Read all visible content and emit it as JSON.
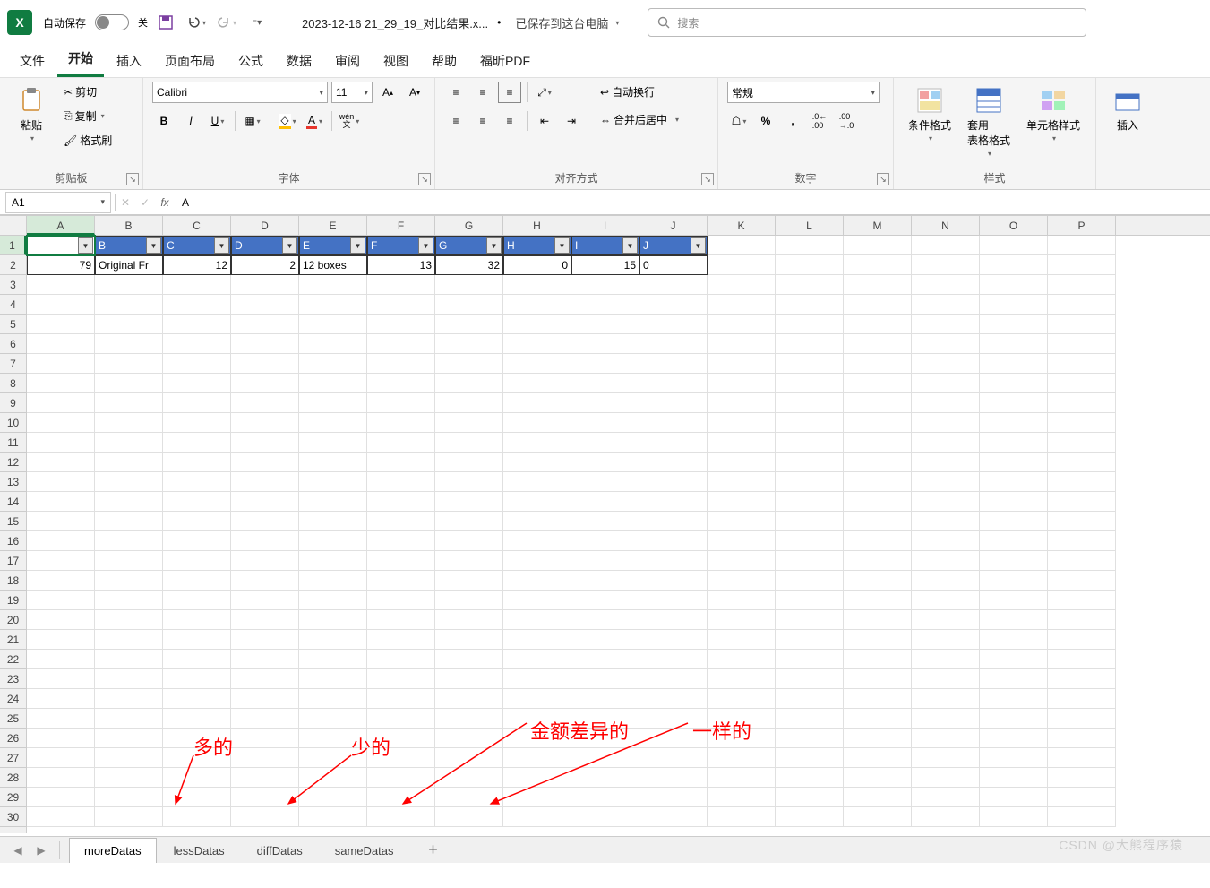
{
  "title": {
    "autosave": "自动保存",
    "autosave_state": "关",
    "filename": "2023-12-16 21_29_19_对比结果.x...",
    "saved": "已保存到这台电脑",
    "search_ph": "搜索"
  },
  "tabs": {
    "file": "文件",
    "home": "开始",
    "insert": "插入",
    "layout": "页面布局",
    "formulas": "公式",
    "data": "数据",
    "review": "审阅",
    "view": "视图",
    "help": "帮助",
    "foxit": "福昕PDF"
  },
  "ribbon": {
    "clipboard": {
      "paste": "粘贴",
      "cut": "剪切",
      "copy": "复制",
      "painter": "格式刷",
      "label": "剪贴板"
    },
    "font": {
      "name": "Calibri",
      "size": "11",
      "label": "字体"
    },
    "align": {
      "wrap": "自动换行",
      "merge": "合并后居中",
      "label": "对齐方式"
    },
    "number": {
      "format": "常规",
      "label": "数字"
    },
    "styles": {
      "cond": "条件格式",
      "table": "套用\n表格格式",
      "cell": "单元格样式",
      "label": "样式"
    },
    "cells": {
      "insert": "插入"
    }
  },
  "formula": {
    "ref": "A1",
    "value": "A"
  },
  "columns": [
    "A",
    "B",
    "C",
    "D",
    "E",
    "F",
    "G",
    "H",
    "I",
    "J",
    "K",
    "L",
    "M",
    "N",
    "O",
    "P"
  ],
  "row_count": 30,
  "header_row": [
    "A",
    "B",
    "C",
    "D",
    "E",
    "F",
    "G",
    "H",
    "I",
    "J"
  ],
  "data_row": [
    "79",
    "Original Fr",
    "12",
    "2",
    "12 boxes",
    "13",
    "32",
    "0",
    "15",
    "0"
  ],
  "data_align": [
    "right",
    "left",
    "right",
    "right",
    "left",
    "right",
    "right",
    "right",
    "right",
    "left"
  ],
  "sheets": {
    "s1": "moreDatas",
    "s2": "lessDatas",
    "s3": "diffDatas",
    "s4": "sameDatas"
  },
  "anno": {
    "a1": "多的",
    "a2": "少的",
    "a3": "金额差异的",
    "a4": "一样的"
  },
  "watermark": "CSDN @大熊程序猿"
}
